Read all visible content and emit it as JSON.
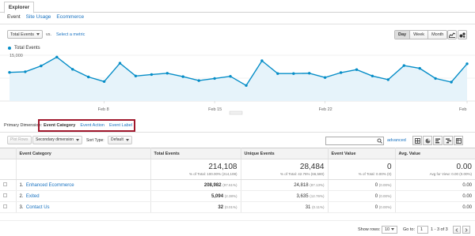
{
  "tabs": {
    "explorer": "Explorer"
  },
  "subnav": {
    "items": [
      "Event",
      "Site Usage",
      "Ecommerce"
    ]
  },
  "metric": {
    "selected": "Total Events",
    "vs": "vs.",
    "select_metric": "Select a metric"
  },
  "range": {
    "day": "Day",
    "week": "Week",
    "month": "Month"
  },
  "legend": {
    "label": "Total Events"
  },
  "chart_data": {
    "type": "area",
    "series": [
      {
        "name": "Total Events",
        "values": [
          9400,
          9600,
          11500,
          14400,
          10400,
          7900,
          6400,
          12400,
          8200,
          8700,
          9100,
          8000,
          6700,
          7400,
          8100,
          5100,
          13200,
          9000,
          9000,
          9100,
          7700,
          9300,
          10300,
          8200,
          7000,
          11600,
          10700,
          7400,
          6200,
          12200
        ]
      }
    ],
    "y_ticks": [
      "15,000",
      "7,500"
    ],
    "x_ticks": [
      "Feb 8",
      "Feb 15",
      "Feb 22",
      "Feb"
    ],
    "ylim": [
      0,
      15000
    ],
    "color": "#058dc7",
    "grid": true
  },
  "primary_dimension": {
    "label": "Primary Dimension:",
    "selected": "Event Category",
    "options": [
      "Event Action",
      "Event Label"
    ]
  },
  "toolbar": {
    "plot_rows": "Plot Rows",
    "secondary_dimension": "Secondary dimension",
    "sort_type_label": "Sort Type:",
    "sort_type_value": "Default",
    "advanced": "advanced"
  },
  "table": {
    "headers": [
      "Event Category",
      "Total Events",
      "Unique Events",
      "Event Value",
      "Avg. Value"
    ],
    "totals": {
      "total_events": "214,108",
      "total_events_sub": "% of Total: 100.00% (214,108)",
      "unique_events": "28,484",
      "unique_events_sub": "% of Total: 42.76% (66,580)",
      "event_value": "0",
      "event_value_sub": "% of Total: 0.00% (0)",
      "avg_value": "0.00",
      "avg_value_sub": "Avg for View: 0.00 (0.00%)"
    },
    "rows": [
      {
        "idx": "1.",
        "name": "Enhanced Ecommerce",
        "total": "208,982",
        "total_pct": "(97.61%)",
        "unique": "24,818",
        "unique_pct": "(87.13%)",
        "value": "0",
        "value_pct": "(0.00%)",
        "avg": "0.00"
      },
      {
        "idx": "2.",
        "name": "Exited",
        "total": "5,094",
        "total_pct": "(2.38%)",
        "unique": "3,635",
        "unique_pct": "(12.76%)",
        "value": "0",
        "value_pct": "(0.00%)",
        "avg": "0.00"
      },
      {
        "idx": "3.",
        "name": "Contact Us",
        "total": "32",
        "total_pct": "(0.01%)",
        "unique": "31",
        "unique_pct": "(0.11%)",
        "value": "0",
        "value_pct": "(0.00%)",
        "avg": "0.00"
      }
    ]
  },
  "footer": {
    "show_rows_label": "Show rows:",
    "show_rows_value": "10",
    "goto_label": "Go to:",
    "goto_value": "1",
    "range_text": "1 - 3 of 3"
  }
}
